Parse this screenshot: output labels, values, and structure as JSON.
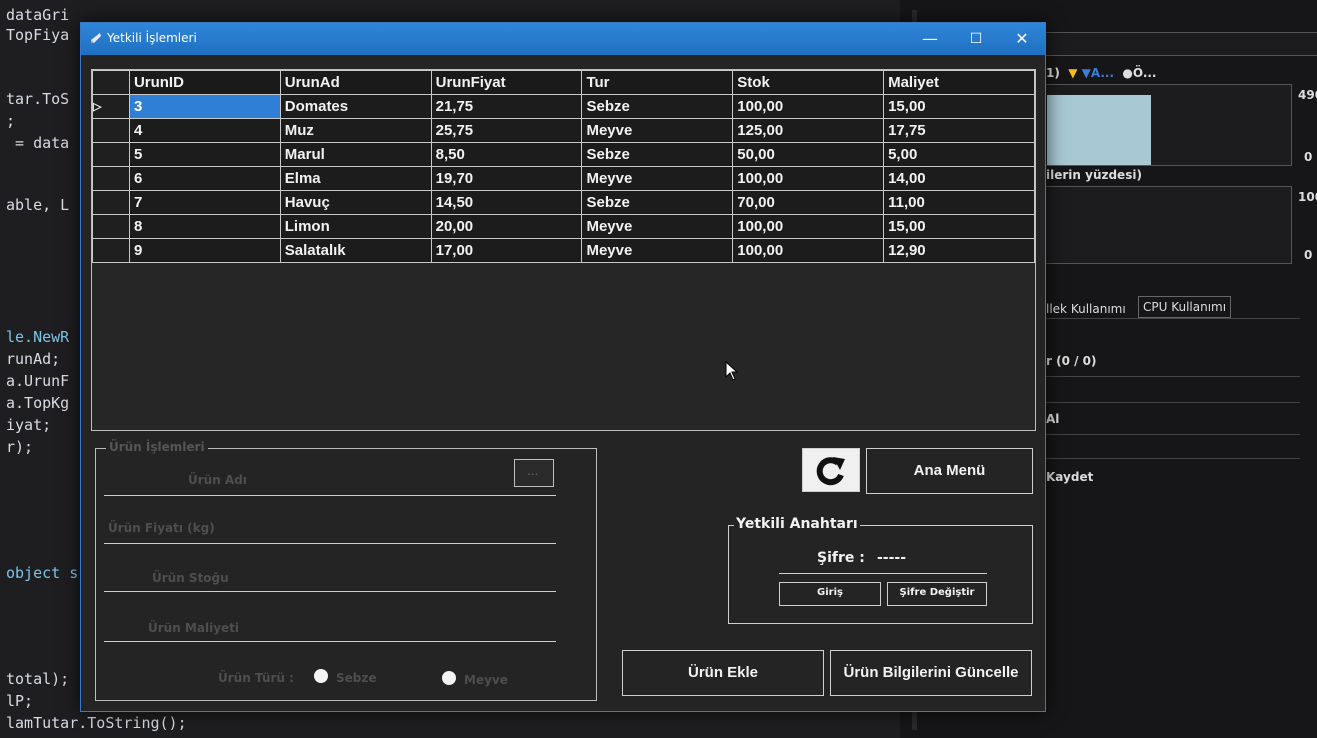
{
  "code": {
    "lines": [
      "dataGri",
      "TopFiya",
      "tar.ToS",
      ";",
      " = data",
      "",
      "able, L",
      "",
      "",
      "",
      "le.NewR",
      "runAd;",
      "a.UrunF",
      "a.TopKg",
      "iyat;",
      "r);",
      "",
      "",
      "object s",
      "",
      "",
      "total);",
      "lP;",
      "lamTutar.ToString();"
    ]
  },
  "right_panel": {
    "legend": "1)  ▼ ▼A...  ●Ö...",
    "legend_a": "▼A...",
    "legend_b": "●Ö...",
    "axis_top_1": "490",
    "axis_bottom_1": "0",
    "chart2_label": "ilerin yüzdesi)",
    "axis_top_2": "100",
    "axis_bottom_2": "0",
    "tabs": [
      "llek Kullanımı",
      "CPU Kullanımı"
    ],
    "item1": "r (0 / 0)",
    "item2": "Al",
    "item3": "Kaydet"
  },
  "window": {
    "title": "Yetkili İşlemleri",
    "minimize": "—",
    "maximize": "☐",
    "close": "✕"
  },
  "grid": {
    "columns": [
      "UrunID",
      "UrunAd",
      "UrunFiyat",
      "Tur",
      "Stok",
      "Maliyet"
    ],
    "current_row_marker": "▷",
    "rows": [
      [
        "3",
        "Domates",
        "21,75",
        "Sebze",
        "100,00",
        "15,00"
      ],
      [
        "4",
        "Muz",
        "25,75",
        "Meyve",
        "125,00",
        "17,75"
      ],
      [
        "5",
        "Marul",
        "8,50",
        "Sebze",
        "50,00",
        "5,00"
      ],
      [
        "6",
        "Elma",
        "19,70",
        "Meyve",
        "100,00",
        "14,00"
      ],
      [
        "7",
        "Havuç",
        "14,50",
        "Sebze",
        "70,00",
        "11,00"
      ],
      [
        "8",
        "Limon",
        "20,00",
        "Meyve",
        "100,00",
        "15,00"
      ],
      [
        "9",
        "Salatalık",
        "17,00",
        "Meyve",
        "100,00",
        "12,90"
      ]
    ]
  },
  "form": {
    "group_title": "Ürün İşlemleri",
    "field1_label": "Ürün Adı",
    "browse": "...",
    "field2_label": "Ürün Fiyatı (kg)",
    "field3_label": "Ürün Stoğu",
    "field4_label": "Ürün Maliyeti",
    "type_label": "Ürün Türü :",
    "radio_sebze": "Sebze",
    "radio_meyve": "Meyve"
  },
  "buttons": {
    "main_menu": "Ana Menü",
    "add_product": "Ürün Ekle",
    "update_product": "Ürün Bilgilerini Güncelle"
  },
  "auth": {
    "title": "Yetkili Anahtarı",
    "password_label": "Şifre :",
    "password_value": "-----",
    "login": "Giriş",
    "change_password": "Şifre Değiştir"
  }
}
